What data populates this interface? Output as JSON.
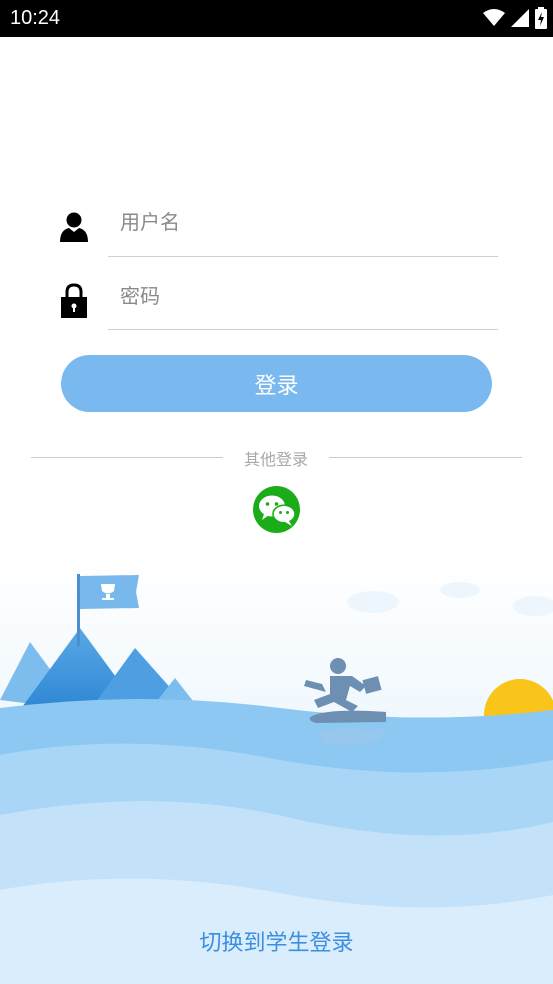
{
  "status_bar": {
    "time": "10:24",
    "icons": [
      "wifi-icon",
      "signal-icon",
      "battery-icon"
    ]
  },
  "form": {
    "username": {
      "placeholder": "用户名",
      "value": "",
      "icon": "user-icon"
    },
    "password": {
      "placeholder": "密码",
      "value": "",
      "icon": "lock-icon"
    },
    "login_button_label": "登录"
  },
  "other_login": {
    "label": "其他登录",
    "icon": "wechat-icon"
  },
  "switch_link": "切换到学生登录",
  "colors": {
    "button": "#7ab9f0",
    "link": "#3d8ee0",
    "wechat": "#1aad19",
    "sun": "#f9c51a",
    "water": "#8cc8f2"
  }
}
